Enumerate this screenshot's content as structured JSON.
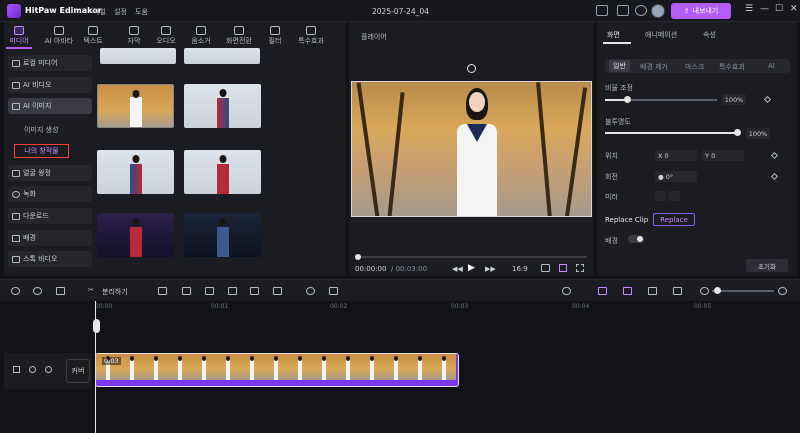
{
  "app": {
    "name": "HitPaw Edimakor",
    "menus": [
      "파일",
      "설정",
      "도움"
    ],
    "project_title": "2025-07-24_04",
    "export_label": "내보내기"
  },
  "media_tabs": [
    "미디어",
    "AI 아바타",
    "텍스트",
    "자막",
    "오디오",
    "음소거",
    "화면전환",
    "필터",
    "특수효과"
  ],
  "left_nav": {
    "items": [
      "로컬 미디어",
      "AI 비디오",
      "AI 이미지"
    ],
    "sub_items": [
      "이미지 생성",
      "나의 창작물"
    ],
    "items2": [
      "얼굴 왕정",
      "녹화",
      "다운로드",
      "배경",
      "스톡 비디오"
    ]
  },
  "viewer": {
    "label": "플레이어",
    "time_current": "00:00:00",
    "time_total": "/ 00:03:00",
    "ratio": "16:9"
  },
  "right_panel": {
    "tabs": [
      "화면",
      "애니메이션",
      "속성"
    ],
    "sub_tabs": [
      "일반",
      "배경 제거",
      "마스크",
      "특수효과",
      "AI"
    ],
    "scale_label": "비율 조정",
    "scale_value": "100%",
    "scale_level": 1.0,
    "opacity_label": "불투명도",
    "opacity_value": "100%",
    "opacity_level": 1.0,
    "position_label": "위치",
    "pos_x_label": "X",
    "pos_x_value": "0",
    "pos_y_label": "Y",
    "pos_y_value": "0",
    "rotation_label": "회전",
    "rotation_value": "0°",
    "mirror_label": "미러",
    "replace_clip_label": "Replace Clip",
    "replace_button": "Replace",
    "bg_label": "배경",
    "reset_button": "초기화"
  },
  "toolbar": {
    "split_label": "분리하기"
  },
  "timeline": {
    "ticks": [
      "00:00",
      "00:01",
      "00:02",
      "00:03",
      "00:04",
      "00:05"
    ],
    "cover_label": "커버",
    "clip_duration": "0:03"
  }
}
